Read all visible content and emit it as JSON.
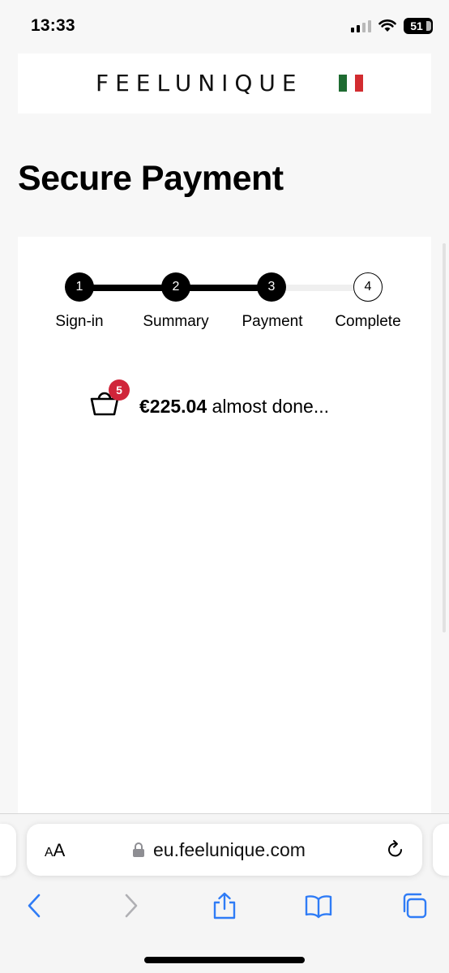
{
  "status_bar": {
    "time": "13:33",
    "battery": "51"
  },
  "header": {
    "logo": "FEELUNIQUE",
    "flag_colors": [
      "#1e6b31",
      "#ffffff",
      "#d22c30"
    ]
  },
  "page": {
    "title": "Secure Payment"
  },
  "checkout_steps": [
    {
      "number": "1",
      "label": "Sign-in",
      "state": "done"
    },
    {
      "number": "2",
      "label": "Summary",
      "state": "done"
    },
    {
      "number": "3",
      "label": "Payment",
      "state": "done"
    },
    {
      "number": "4",
      "label": "Complete",
      "state": "todo"
    }
  ],
  "basket": {
    "count": "5",
    "amount": "€225.04",
    "message": "almost done..."
  },
  "browser": {
    "aa_label_small": "A",
    "aa_label_large": "A",
    "url": "eu.feelunique.com"
  },
  "colors": {
    "badge": "#d0253a",
    "step_done": "#000000",
    "step_todo": "#efefef",
    "safari_blue": "#2f7cf6"
  }
}
